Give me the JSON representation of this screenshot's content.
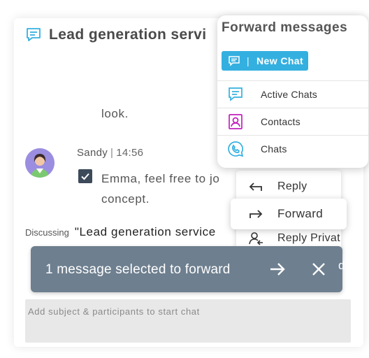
{
  "chat": {
    "title": "Lead generation servi",
    "prev_message_tail": "look.",
    "sender": "Sandy",
    "time": "14:56",
    "message_line1": "Emma, feel free to jo",
    "message_line2": "concept.",
    "discussing_label": "Discussing",
    "discussing_topic": "\"Lead generation service"
  },
  "forward_popup": {
    "title": "Forward messages",
    "new_chat_label": "New Chat",
    "items": [
      {
        "label": "Active Chats",
        "icon": "chat-bubble-icon"
      },
      {
        "label": "Contacts",
        "icon": "contact-card-icon"
      },
      {
        "label": "Chats",
        "icon": "phone-bubble-icon"
      }
    ]
  },
  "context_menu": {
    "reply": "Reply",
    "forward": "Forward",
    "reply_private": "Reply Privat"
  },
  "selection_bar": {
    "text": "1 message selected to forward",
    "hint_char": "d"
  },
  "composer": {
    "placeholder": "Add subject & participants to start chat"
  },
  "colors": {
    "accent": "#34b0e0",
    "contacts_icon": "#c21fbe",
    "selection_bar": "#6e7f8f",
    "checkbox": "#3c4a5a"
  }
}
